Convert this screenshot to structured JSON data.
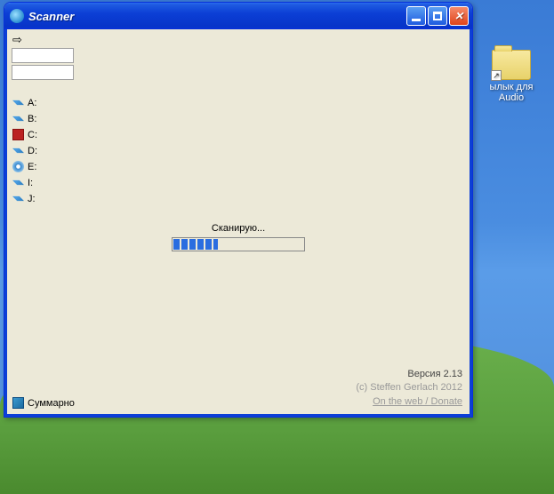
{
  "desktop": {
    "shortcut_label": "ылык для\nAudio"
  },
  "window": {
    "title": "Scanner"
  },
  "drives": [
    {
      "icon": "remov",
      "label": "A:"
    },
    {
      "icon": "remov",
      "label": "B:"
    },
    {
      "icon": "hdd",
      "label": "C:"
    },
    {
      "icon": "remov",
      "label": "D:"
    },
    {
      "icon": "cd",
      "label": "E:"
    },
    {
      "icon": "remov",
      "label": "I:"
    },
    {
      "icon": "remov",
      "label": "J:"
    }
  ],
  "scan": {
    "label": "Сканирую...",
    "progress_percent": 34
  },
  "summary_label": "Суммарно",
  "footer": {
    "version": "Версия 2.13",
    "copyright": "(c) Steffen Gerlach 2012",
    "link": "On the web / Donate"
  }
}
